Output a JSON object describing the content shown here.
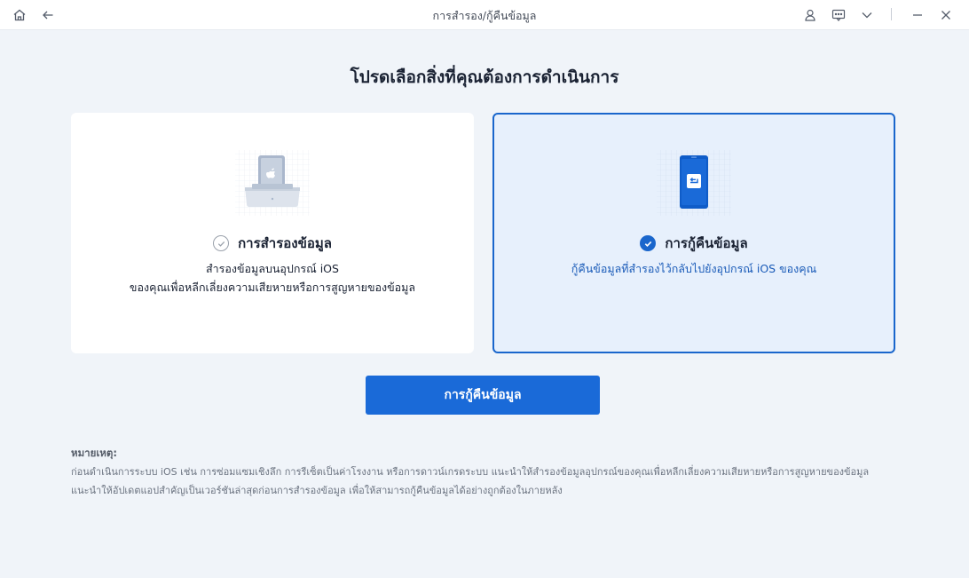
{
  "window": {
    "title": "การสำรอง/กู้คืนข้อมูล",
    "icons": [
      "home-icon",
      "back-arrow-icon",
      "user-icon",
      "feedback-icon",
      "chevron-down-icon",
      "minimize-icon",
      "close-icon"
    ]
  },
  "main": {
    "heading": "โปรดเลือกสิ่งที่คุณต้องการดำเนินการ",
    "cards": [
      {
        "id": "backup",
        "title": "การสำรองข้อมูล",
        "desc_line1": "สำรองข้อมูลบนอุปกรณ์ iOS",
        "desc_line2": "ของคุณเพื่อหลีกเลี่ยงความเสียหายหรือการสูญหายของข้อมูล",
        "selected": false
      },
      {
        "id": "restore",
        "title": "การกู้คืนข้อมูล",
        "desc_line1": "กู้คืนข้อมูลที่สำรองไว้กลับไปยังอุปกรณ์ iOS ของคุณ",
        "selected": true
      }
    ],
    "action_button": "การกู้คืนข้อมูล"
  },
  "note": {
    "label": "หมายเหตุ:",
    "line1": "ก่อนดำเนินการระบบ iOS เช่น การซ่อมแซมเชิงลึก การรีเซ็ตเป็นค่าโรงงาน หรือการดาวน์เกรดระบบ แนะนำให้สำรองข้อมูลอุปกรณ์ของคุณเพื่อหลีกเลี่ยงความเสียหายหรือการสูญหายของข้อมูล",
    "line2": "แนะนำให้อัปเดตแอปสำคัญเป็นเวอร์ชันล่าสุดก่อนการสำรองข้อมูล เพื่อให้สามารถกู้คืนข้อมูลได้อย่างถูกต้องในภายหลัง"
  },
  "colors": {
    "accent": "#1a6ad8",
    "selected_border": "#1a66cc",
    "selected_bg": "#e7f0fc",
    "page_bg": "#f0f4f9"
  }
}
